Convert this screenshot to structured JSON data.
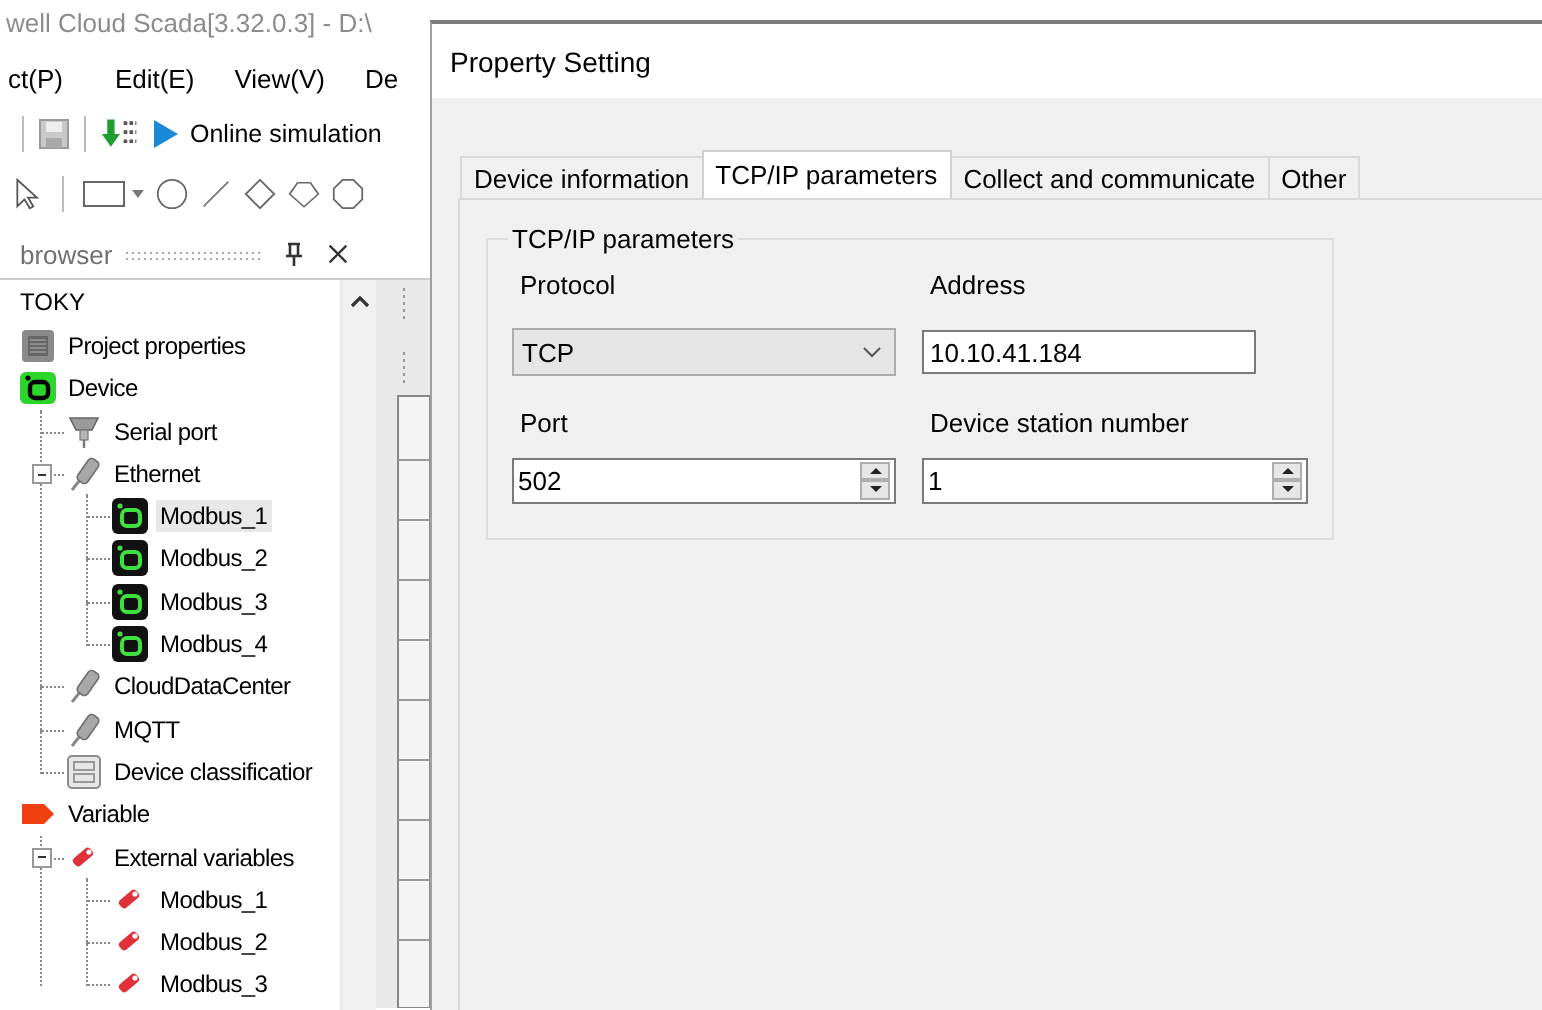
{
  "app": {
    "title": "well Cloud Scada[3.32.0.3] - D:\\",
    "menu": [
      "ct(P)",
      "Edit(E)",
      "View(V)",
      "De"
    ],
    "toolbar": {
      "simulation_label": "Online simulation"
    },
    "browser": {
      "title": "browser",
      "root": "TOKY",
      "tree": [
        {
          "label": "Project properties",
          "kind": "properties",
          "selected": false
        },
        {
          "label": "Device",
          "kind": "device",
          "selected": false,
          "children": [
            {
              "label": "Serial port",
              "kind": "serial",
              "selected": false
            },
            {
              "label": "Ethernet",
              "kind": "cable",
              "selected": false,
              "expanded": true,
              "children": [
                {
                  "label": "Modbus_1",
                  "kind": "modbus",
                  "selected": true
                },
                {
                  "label": "Modbus_2",
                  "kind": "modbus",
                  "selected": false
                },
                {
                  "label": "Modbus_3",
                  "kind": "modbus",
                  "selected": false
                },
                {
                  "label": "Modbus_4",
                  "kind": "modbus",
                  "selected": false
                }
              ]
            },
            {
              "label": "CloudDataCenter",
              "kind": "cable",
              "selected": false
            },
            {
              "label": "MQTT",
              "kind": "cable",
              "selected": false
            },
            {
              "label": "Device classificatior",
              "kind": "cabinet",
              "selected": false
            }
          ]
        },
        {
          "label": "Variable",
          "kind": "variable",
          "selected": false,
          "children": [
            {
              "label": "External variables",
              "kind": "pin",
              "selected": false,
              "expanded": true,
              "children": [
                {
                  "label": "Modbus_1",
                  "kind": "pin",
                  "selected": false
                },
                {
                  "label": "Modbus_2",
                  "kind": "pin",
                  "selected": false
                },
                {
                  "label": "Modbus_3",
                  "kind": "pin",
                  "selected": false
                }
              ]
            }
          ]
        }
      ]
    }
  },
  "dialog": {
    "title": "Property Setting",
    "tabs": [
      {
        "label": "Device information",
        "selected": false
      },
      {
        "label": "TCP/IP parameters",
        "selected": true
      },
      {
        "label": "Collect and communicate",
        "selected": false
      },
      {
        "label": "Other",
        "selected": false
      }
    ],
    "group": {
      "title": "TCP/IP parameters",
      "protocol": {
        "label": "Protocol",
        "value": "TCP"
      },
      "address": {
        "label": "Address",
        "value": "10.10.41.184"
      },
      "port": {
        "label": "Port",
        "value": "502"
      },
      "station": {
        "label": "Device station number",
        "value": "1"
      }
    }
  }
}
